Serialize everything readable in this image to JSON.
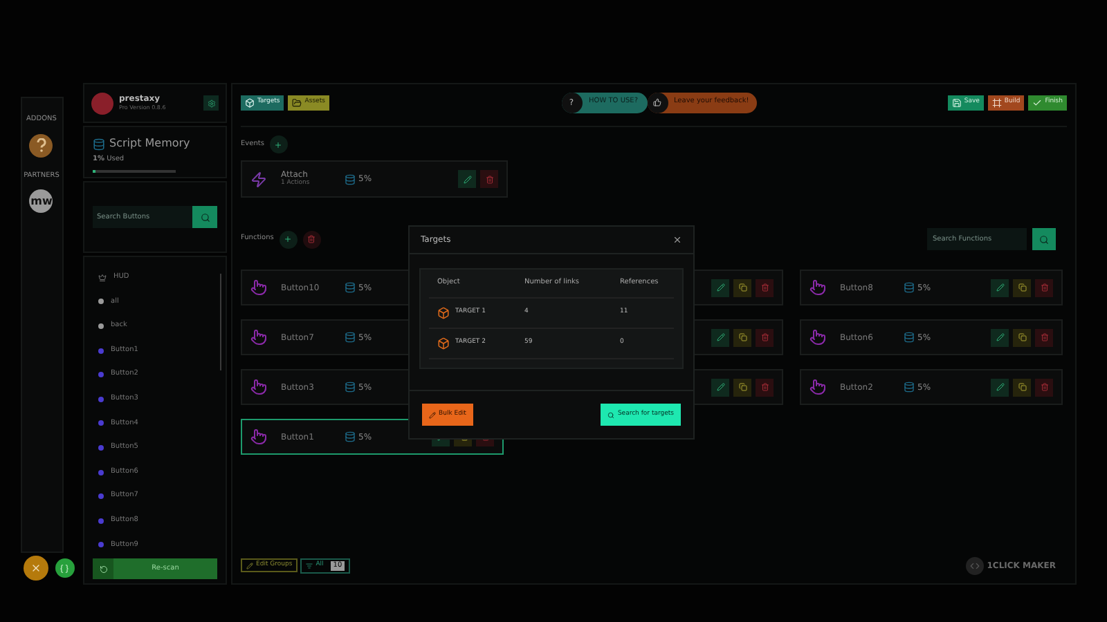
{
  "rail": {
    "sections": [
      {
        "label": "ADDONS",
        "kind": "help"
      },
      {
        "label": "PARTNERS",
        "kind": "partner",
        "badge": "mw"
      }
    ]
  },
  "fabs": [
    {
      "kind": "close"
    },
    {
      "kind": "code"
    }
  ],
  "profile": {
    "name": "prestaxy",
    "version": "Pro Version 0.8.6"
  },
  "memory": {
    "title": "Script Memory",
    "used": "**1%** Used",
    "level": 0.01
  },
  "button_search": {
    "placeholder": "Search Buttons"
  },
  "tree": [
    {
      "label": "HUD",
      "kind": "group"
    },
    {
      "label": "all",
      "kind": "item",
      "color": "#9a9a9a"
    },
    {
      "label": "back",
      "kind": "item",
      "color": "#9a9a9a"
    },
    {
      "label": "Button1",
      "kind": "item",
      "color": "#4a3bd0"
    },
    {
      "label": "Button2",
      "kind": "item",
      "color": "#4a3bd0"
    },
    {
      "label": "Button3",
      "kind": "item",
      "color": "#4a3bd0"
    },
    {
      "label": "Button4",
      "kind": "item",
      "color": "#4a3bd0"
    },
    {
      "label": "Button5",
      "kind": "item",
      "color": "#4a3bd0"
    },
    {
      "label": "Button6",
      "kind": "item",
      "color": "#4a3bd0"
    },
    {
      "label": "Button7",
      "kind": "item",
      "color": "#4a3bd0"
    },
    {
      "label": "Button8",
      "kind": "item",
      "color": "#4a3bd0"
    },
    {
      "label": "Button9",
      "kind": "item",
      "color": "#4a3bd0"
    }
  ],
  "rescan": "Re-scan",
  "toolbar": {
    "left": [
      {
        "kind": "targets",
        "label": "Targets"
      },
      {
        "kind": "assets",
        "label": "Assets"
      }
    ],
    "help": {
      "icon": "?",
      "label": "HOW TO USE?"
    },
    "feedback": "Leave your feedback!",
    "right": [
      {
        "kind": "save",
        "label": "Save"
      },
      {
        "kind": "build",
        "label": "Build"
      },
      {
        "kind": "finish",
        "label": "Finish"
      }
    ]
  },
  "events": {
    "title": "Events",
    "items": [
      {
        "name": "Attach",
        "subtitle": "1 Actions",
        "memory": "5%"
      }
    ]
  },
  "functions": {
    "title": "Functions",
    "search_placeholder": "Search Functions",
    "items": [
      {
        "kind": "left",
        "name": "Button10",
        "memory": "5%",
        "selected": false
      },
      {
        "kind": "covered",
        "selected": false
      },
      {
        "kind": "card",
        "name": "Button8",
        "memory": "5%",
        "selected": false
      },
      {
        "kind": "left",
        "name": "Button7",
        "memory": "5%",
        "selected": false
      },
      {
        "kind": "covered",
        "selected": false
      },
      {
        "kind": "card",
        "name": "Button6",
        "memory": "5%",
        "selected": false
      },
      {
        "kind": "left",
        "name": "Button3",
        "memory": "5%",
        "selected": false
      },
      {
        "kind": "covered",
        "selected": false
      },
      {
        "kind": "card",
        "name": "Button2",
        "memory": "5%",
        "selected": false
      },
      {
        "kind": "card",
        "name": "Button1",
        "memory": "5%",
        "selected": true
      }
    ]
  },
  "bottom": {
    "edit_groups": "Edit Groups",
    "filter": "All",
    "count": "10"
  },
  "logo": "1CLICK MAKER",
  "modal": {
    "title": "Targets",
    "columns": [
      "Object",
      "Number of links",
      "References"
    ],
    "rows": [
      {
        "name": "TARGET 1",
        "links": "4",
        "references": "11"
      },
      {
        "name": "TARGET 2",
        "links": "59",
        "references": "0"
      }
    ],
    "bulk_edit": "Bulk Edit",
    "search_targets": "Search for targets"
  }
}
